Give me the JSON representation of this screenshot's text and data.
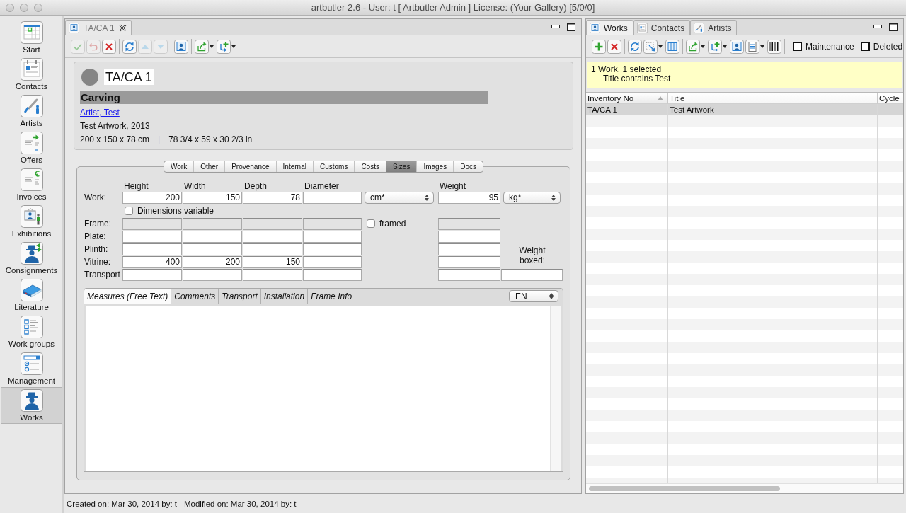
{
  "window": {
    "title": "artbutler 2.6 - User: t [ Artbutler Admin ] License: (Your Gallery) [5/0/0]"
  },
  "sidebar": {
    "items": [
      {
        "label": "Start",
        "selected": false
      },
      {
        "label": "Contacts",
        "selected": false
      },
      {
        "label": "Artists",
        "selected": false
      },
      {
        "label": "Offers",
        "selected": false
      },
      {
        "label": "Invoices",
        "selected": false
      },
      {
        "label": "Exhibitions",
        "selected": false
      },
      {
        "label": "Consignments",
        "selected": false
      },
      {
        "label": "Literature",
        "selected": false
      },
      {
        "label": "Work groups",
        "selected": false
      },
      {
        "label": "Management",
        "selected": false
      },
      {
        "label": "Works",
        "selected": true
      }
    ]
  },
  "editor": {
    "tab_label": "TA/CA 1",
    "toolbar": [
      {
        "disabled": true
      },
      {
        "disabled": true
      },
      {
        "disabled": false
      },
      {
        "disabled": false
      },
      {
        "disabled": true
      },
      {
        "disabled": true
      },
      {
        "disabled": false
      },
      {
        "disabled": false
      },
      {
        "disabled": false
      }
    ],
    "header": {
      "inventory_no": "TA/CA 1",
      "category": "Carving",
      "artist": "Artist, Test",
      "title_year": "Test Artwork, 2013",
      "size_metric": "200 x 150 x 78 cm",
      "separator": "|",
      "size_imperial": "78 3/4 x 59 x 30 2/3 in"
    },
    "sections": [
      {
        "label": "Work",
        "selected": false
      },
      {
        "label": "Other",
        "selected": false
      },
      {
        "label": "Provenance",
        "selected": false
      },
      {
        "label": "Internal",
        "selected": false
      },
      {
        "label": "Customs",
        "selected": false
      },
      {
        "label": "Costs",
        "selected": false
      },
      {
        "label": "Sizes",
        "selected": true
      },
      {
        "label": "Images",
        "selected": false
      },
      {
        "label": "Docs",
        "selected": false
      }
    ],
    "sizes": {
      "columns": [
        "Height",
        "Width",
        "Depth",
        "Diameter"
      ],
      "unit": "cm*",
      "weight_label": "Weight",
      "weight_unit": "kg*",
      "variable": {
        "label": "Dimensions variable",
        "checked": false
      },
      "rows": [
        {
          "label": "Work:",
          "cells": [
            "200",
            "150",
            "78"
          ],
          "weight": "95",
          "disabled": false
        },
        {
          "label": "Frame:",
          "disabled": true,
          "checkbox": {
            "label": "framed",
            "checked": false
          }
        },
        {
          "label": "Plate:",
          "disabled": false
        },
        {
          "label": "Plinth:",
          "disabled": false
        },
        {
          "label": "Vitrine:",
          "cells": [
            "400",
            "200",
            "150"
          ],
          "disabled": false
        },
        {
          "label": "Transport",
          "disabled": false
        }
      ],
      "weight_boxed": {
        "label": "Weight boxed:"
      }
    },
    "notes": {
      "tabs": [
        {
          "label": "Measures (Free Text)",
          "selected": true
        },
        {
          "label": "Comments",
          "selected": false
        },
        {
          "label": "Transport",
          "selected": false
        },
        {
          "label": "Installation",
          "selected": false
        },
        {
          "label": "Frame Info",
          "selected": false
        }
      ],
      "language": "EN"
    }
  },
  "browser": {
    "tabs": [
      {
        "label": "Works",
        "selected": true
      },
      {
        "label": "Contacts",
        "selected": false
      },
      {
        "label": "Artists",
        "selected": false
      }
    ],
    "filters": [
      {
        "label": "Maintenance",
        "checked": false
      },
      {
        "label": "Deleted",
        "checked": false
      }
    ],
    "info": {
      "summary": "1 Work, 1 selected",
      "criteria": "Title contains Test"
    },
    "table": {
      "columns": [
        {
          "label": "Inventory No",
          "sorted": true
        },
        {
          "label": "Title",
          "sorted": false
        },
        {
          "label": "Cycle",
          "sorted": false
        }
      ],
      "rows": [
        {
          "cells": [
            "TA/CA 1",
            "Test Artwork"
          ],
          "selected": true
        }
      ]
    }
  },
  "status_bar": {
    "created": "Created on: Mar 30, 2014 by: t",
    "modified": "Modified on: Mar 30, 2014 by: t"
  }
}
